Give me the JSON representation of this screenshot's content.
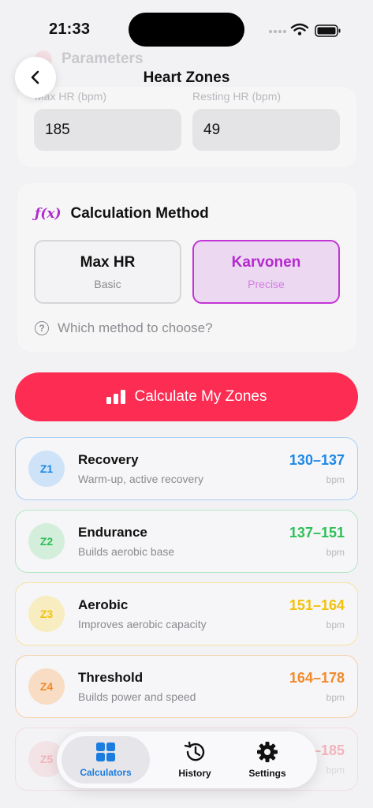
{
  "status": {
    "time": "21:33"
  },
  "header": {
    "title": "Heart Zones",
    "ghost_section": "Parameters"
  },
  "params": {
    "max_hr_label": "Max HR (bpm)",
    "max_hr_value": "185",
    "resting_hr_label": "Resting HR (bpm)",
    "resting_hr_value": "49"
  },
  "method": {
    "icon_text": "ƒ(x)",
    "title": "Calculation Method",
    "options": [
      {
        "title": "Max HR",
        "subtitle": "Basic",
        "selected": false
      },
      {
        "title": "Karvonen",
        "subtitle": "Precise",
        "selected": true
      }
    ],
    "help_text": "Which method to choose?"
  },
  "calculate": {
    "label": "Calculate My Zones"
  },
  "zones": [
    {
      "badge": "Z1",
      "name": "Recovery",
      "desc": "Warm-up, active recovery",
      "range": "130–137",
      "unit": "bpm",
      "color": "#1e88e5",
      "border": "#a9cff5",
      "badge_bg": "#cfe3f8"
    },
    {
      "badge": "Z2",
      "name": "Endurance",
      "desc": "Builds aerobic base",
      "range": "137–151",
      "unit": "bpm",
      "color": "#2fbf57",
      "border": "#b4e6c3",
      "badge_bg": "#d3efdb"
    },
    {
      "badge": "Z3",
      "name": "Aerobic",
      "desc": "Improves aerobic capacity",
      "range": "151–164",
      "unit": "bpm",
      "color": "#f2c20c",
      "border": "#f5e3a2",
      "badge_bg": "#f8edc0"
    },
    {
      "badge": "Z4",
      "name": "Threshold",
      "desc": "Builds power and speed",
      "range": "164–178",
      "unit": "bpm",
      "color": "#f2892a",
      "border": "#f6cfa8",
      "badge_bg": "#f8dcc4"
    },
    {
      "badge": "Z5",
      "name": "",
      "desc": "",
      "range": "–185",
      "unit": "bpm",
      "color": "#f26a78",
      "border": "#f4c3c8",
      "badge_bg": "#f6d3d6"
    }
  ],
  "tabs": [
    {
      "label": "Calculators",
      "active": true
    },
    {
      "label": "History",
      "active": false
    },
    {
      "label": "Settings",
      "active": false
    }
  ],
  "colors": {
    "accent": "#fd2c52",
    "method_accent": "#c235d6",
    "tab_active": "#1c7ce0"
  }
}
